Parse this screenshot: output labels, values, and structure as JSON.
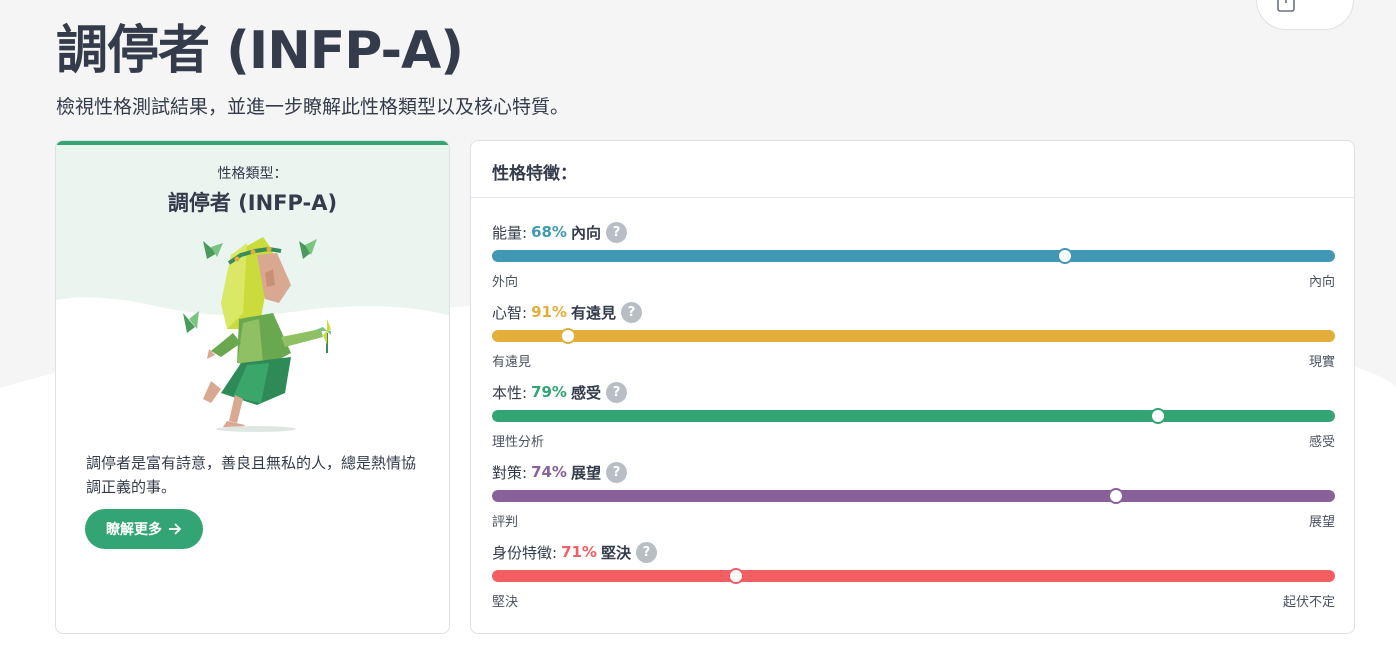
{
  "header": {
    "title": "調停者 (INFP-A)",
    "subtitle": "檢視性格測試結果，並進一步瞭解此性格類型以及核心特質。"
  },
  "toolbar": {
    "share_icon": "share-icon",
    "more_icon": "more-horizontal-icon"
  },
  "type_card": {
    "label": "性格類型：",
    "name": "調停者 (INFP-A)",
    "description": "調停者是富有詩意，善良且無私的人，總是熱情協調正義的事。",
    "button_label": "瞭解更多",
    "button_icon": "arrow-right-icon",
    "accent_color": "#33a474"
  },
  "traits": {
    "title": "性格特徵：",
    "help_label": "?",
    "items": [
      {
        "name": "能量:",
        "percent": "68%",
        "side": "內向",
        "left_label": "外向",
        "right_label": "內向",
        "color": "#4298b4",
        "value": 68
      },
      {
        "name": "心智:",
        "percent": "91%",
        "side": "有遠見",
        "left_label": "有遠見",
        "right_label": "現實",
        "color": "#e4ae3a",
        "value": 9
      },
      {
        "name": "本性:",
        "percent": "79%",
        "side": "感受",
        "left_label": "理性分析",
        "right_label": "感受",
        "color": "#33a474",
        "value": 79
      },
      {
        "name": "對策:",
        "percent": "74%",
        "side": "展望",
        "left_label": "評判",
        "right_label": "展望",
        "color": "#88619a",
        "value": 74
      },
      {
        "name": "身份特徵:",
        "percent": "71%",
        "side": "堅決",
        "left_label": "堅決",
        "right_label": "起伏不定",
        "color": "#f25e62",
        "value": 29
      }
    ]
  }
}
